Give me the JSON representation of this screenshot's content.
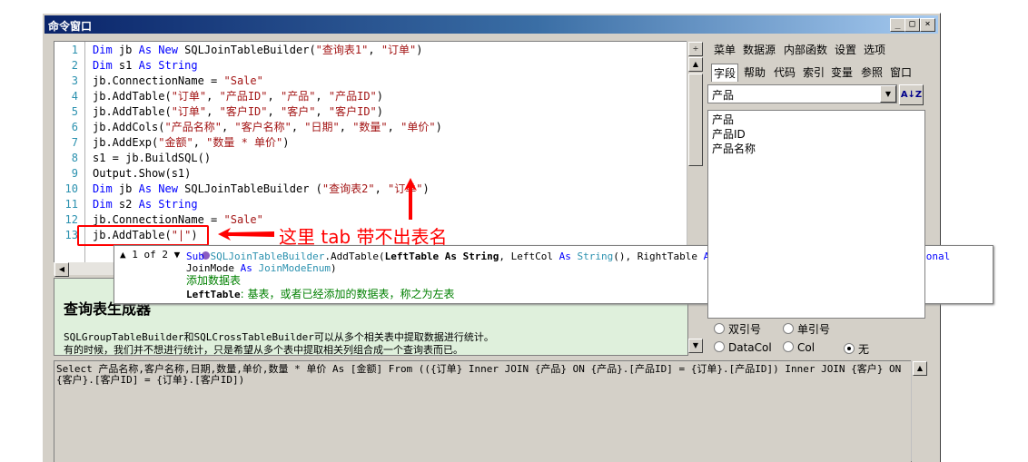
{
  "window": {
    "title": "命令窗口",
    "min": "_",
    "max": "□",
    "close": "×"
  },
  "editor": {
    "line_numbers": [
      "1",
      "2",
      "3",
      "4",
      "5",
      "6",
      "7",
      "8",
      "9",
      "10",
      "11",
      "12",
      "13"
    ],
    "lines": [
      [
        {
          "t": "Dim ",
          "c": "kw"
        },
        {
          "t": "jb "
        },
        {
          "t": "As New ",
          "c": "kw"
        },
        {
          "t": "SQLJoinTableBuilder("
        },
        {
          "t": "\"查询表1\"",
          "c": "str"
        },
        {
          "t": ", "
        },
        {
          "t": "\"订单\"",
          "c": "str"
        },
        {
          "t": ")"
        }
      ],
      [
        {
          "t": "Dim ",
          "c": "kw"
        },
        {
          "t": "s1 "
        },
        {
          "t": "As String",
          "c": "kw"
        }
      ],
      [
        {
          "t": "jb.ConnectionName = "
        },
        {
          "t": "\"Sale\"",
          "c": "str"
        }
      ],
      [
        {
          "t": "jb.AddTable("
        },
        {
          "t": "\"订单\"",
          "c": "str"
        },
        {
          "t": ", "
        },
        {
          "t": "\"产品ID\"",
          "c": "str"
        },
        {
          "t": ", "
        },
        {
          "t": "\"产品\"",
          "c": "str"
        },
        {
          "t": ", "
        },
        {
          "t": "\"产品ID\"",
          "c": "str"
        },
        {
          "t": ")"
        }
      ],
      [
        {
          "t": "jb.AddTable("
        },
        {
          "t": "\"订单\"",
          "c": "str"
        },
        {
          "t": ", "
        },
        {
          "t": "\"客户ID\"",
          "c": "str"
        },
        {
          "t": ", "
        },
        {
          "t": "\"客户\"",
          "c": "str"
        },
        {
          "t": ", "
        },
        {
          "t": "\"客户ID\"",
          "c": "str"
        },
        {
          "t": ")"
        }
      ],
      [
        {
          "t": "jb.AddCols("
        },
        {
          "t": "\"产品名称\"",
          "c": "str"
        },
        {
          "t": ", "
        },
        {
          "t": "\"客户名称\"",
          "c": "str"
        },
        {
          "t": ", "
        },
        {
          "t": "\"日期\"",
          "c": "str"
        },
        {
          "t": ", "
        },
        {
          "t": "\"数量\"",
          "c": "str"
        },
        {
          "t": ", "
        },
        {
          "t": "\"单价\"",
          "c": "str"
        },
        {
          "t": ")"
        }
      ],
      [
        {
          "t": "jb.AddExp("
        },
        {
          "t": "\"金额\"",
          "c": "str"
        },
        {
          "t": ", "
        },
        {
          "t": "\"数量 * 单价\"",
          "c": "str"
        },
        {
          "t": ")"
        }
      ],
      [
        {
          "t": "s1 = jb.BuildSQL()"
        }
      ],
      [
        {
          "t": "Output.Show(s1)"
        }
      ],
      [
        {
          "t": "Dim ",
          "c": "kw"
        },
        {
          "t": "jb "
        },
        {
          "t": "As New ",
          "c": "kw"
        },
        {
          "t": "SQLJoinTableBuilder ("
        },
        {
          "t": "\"查询表2\"",
          "c": "str"
        },
        {
          "t": ", "
        },
        {
          "t": "\"订单\"",
          "c": "str"
        },
        {
          "t": ")"
        }
      ],
      [
        {
          "t": "Dim ",
          "c": "kw"
        },
        {
          "t": "s2 "
        },
        {
          "t": "As String",
          "c": "kw"
        }
      ],
      [
        {
          "t": "jb.ConnectionName = "
        },
        {
          "t": "\"Sale\"",
          "c": "str"
        }
      ],
      [
        {
          "t": "jb.AddTable("
        },
        {
          "t": "\"|\"",
          "c": "str"
        },
        {
          "t": ")"
        }
      ]
    ]
  },
  "annotation": {
    "text": "这里 tab 带不出表名",
    "color": "#ff0000"
  },
  "tooltip": {
    "nav": "▲ 1 of 2 ▼",
    "signature": [
      {
        "t": "Sub ",
        "c": "kw"
      },
      {
        "t": "SQLJoinTableBuilder",
        "c": "ty"
      },
      {
        "t": ".AddTable("
      },
      {
        "t": "LeftTable As String",
        "c": "b"
      },
      {
        "t": ", LeftCol "
      },
      {
        "t": "As ",
        "c": "kw"
      },
      {
        "t": "String",
        "c": "ty"
      },
      {
        "t": "(), RightTable "
      },
      {
        "t": "As ",
        "c": "kw"
      },
      {
        "t": "String",
        "c": "ty"
      },
      {
        "t": ", RightCol "
      },
      {
        "t": "As ",
        "c": "kw"
      },
      {
        "t": "String",
        "c": "ty"
      },
      {
        "t": "(), "
      },
      {
        "t": "Optional ",
        "c": "kw"
      },
      {
        "t": "JoinMode "
      },
      {
        "t": "As ",
        "c": "kw"
      },
      {
        "t": "JoinModeEnum",
        "c": "ty"
      },
      {
        "t": ")"
      }
    ],
    "description": "添加数据表",
    "param_name": "LeftTable",
    "param_desc": ": 基表，或者已经添加的数据表，称之为左表"
  },
  "help": {
    "title": "查询表生成器",
    "p1": "SQLGroupTableBuilder和SQLCrossTableBuilder可以从多个相关表中提取数据进行统计。",
    "p2": "有的时候，我们并不想进行统计，只是希望从多个表中提取相关列组合成一个查询表而已。"
  },
  "right_panel": {
    "menu": [
      "菜单",
      "数据源",
      "内部函数",
      "设置",
      "选项"
    ],
    "tabs": [
      "字段",
      "帮助",
      "代码",
      "索引",
      "变量",
      "参照",
      "窗口"
    ],
    "active_tab": "字段",
    "table_select": "产品",
    "sort_label": "A↓Z",
    "fields": [
      "产品",
      "产品ID",
      "产品名称"
    ],
    "radios_row1": [
      "双引号",
      "单引号"
    ],
    "radios_row2": [
      "DataCol",
      "Col",
      "无"
    ],
    "radio_selected": "无"
  },
  "output": {
    "text": "Select  产品名称,客户名称,日期,数量,单价,数量 * 单价 As [金额] From (({订单} Inner JOIN {产品} ON {产品}.[产品ID] = {订单}.[产品ID]) Inner JOIN {客户} ON {客户}.[客户ID] = {订单}.[客户ID])"
  }
}
